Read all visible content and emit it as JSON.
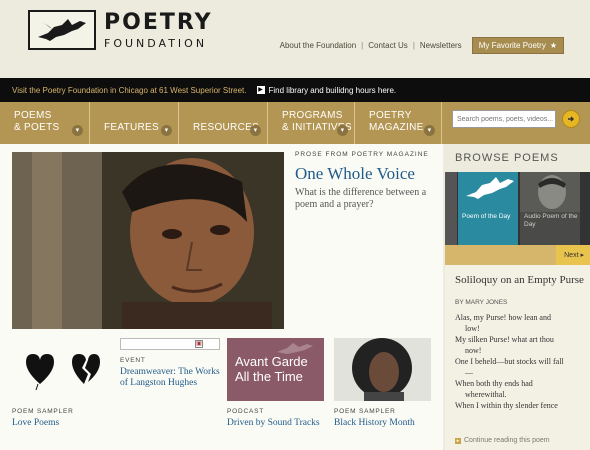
{
  "brand": {
    "line1": "POETRY",
    "line2": "FOUNDATION"
  },
  "toplinks": {
    "about": "About the Foundation",
    "contact": "Contact Us",
    "newsletters": "Newsletters",
    "favorite": "My Favorite Poetry"
  },
  "announcement": {
    "visit": "Visit the Poetry Foundation in Chicago at 61 West Superior Street.",
    "hours": "Find library and builidng hours here."
  },
  "nav": {
    "items": [
      {
        "line1": "POEMS",
        "line2": "& POETS"
      },
      {
        "line1": "",
        "line2": "FEATURES"
      },
      {
        "line1": "",
        "line2": "RESOURCES"
      },
      {
        "line1": "PROGRAMS",
        "line2": "& INITIATIVES"
      },
      {
        "line1": "POETRY",
        "line2": "MAGAZINE"
      }
    ],
    "search_placeholder": "Search poems, poets, videos..."
  },
  "hero": {
    "label": "PROSE FROM POETRY MAGAZINE",
    "title": "One Whole Voice",
    "subtitle": "What is the difference between a poem and a prayer?"
  },
  "cards": [
    {
      "category": "POEM SAMPLER",
      "title": "Love Poems"
    },
    {
      "category": "EVENT",
      "title": "Dreamweaver: The Works of Langston Hughes"
    },
    {
      "category": "PODCAST",
      "title": "Driven by Sound Tracks",
      "image_text": "Avant Garde All the Time"
    },
    {
      "category": "POEM SAMPLER",
      "title": "Black History Month"
    }
  ],
  "browse": {
    "heading": "BROWSE POEMS",
    "thumb1": "Poem of the Day",
    "thumb2": "Audio Poem of the Day",
    "next": "Next"
  },
  "poem": {
    "title": "Soliloquy on an Empty Purse",
    "author": "BY MARY JONES",
    "lines": [
      {
        "text": "Alas, my Purse! how lean and",
        "indent": false
      },
      {
        "text": "low!",
        "indent": true
      },
      {
        "text": "My silken Purse! what art thou",
        "indent": false
      },
      {
        "text": "now!",
        "indent": true
      },
      {
        "text": "One I beheld—but stocks will fall",
        "indent": false
      },
      {
        "text": "—",
        "indent": true
      },
      {
        "text": "When both thy ends had",
        "indent": false
      },
      {
        "text": "wherewithal.",
        "indent": true
      },
      {
        "text": "When I within thy slender fence",
        "indent": false
      }
    ],
    "continue": "Continue reading this poem"
  },
  "colors": {
    "accent": "#b39653",
    "link": "#205b8a",
    "dark_bar": "#0d0d0d"
  }
}
